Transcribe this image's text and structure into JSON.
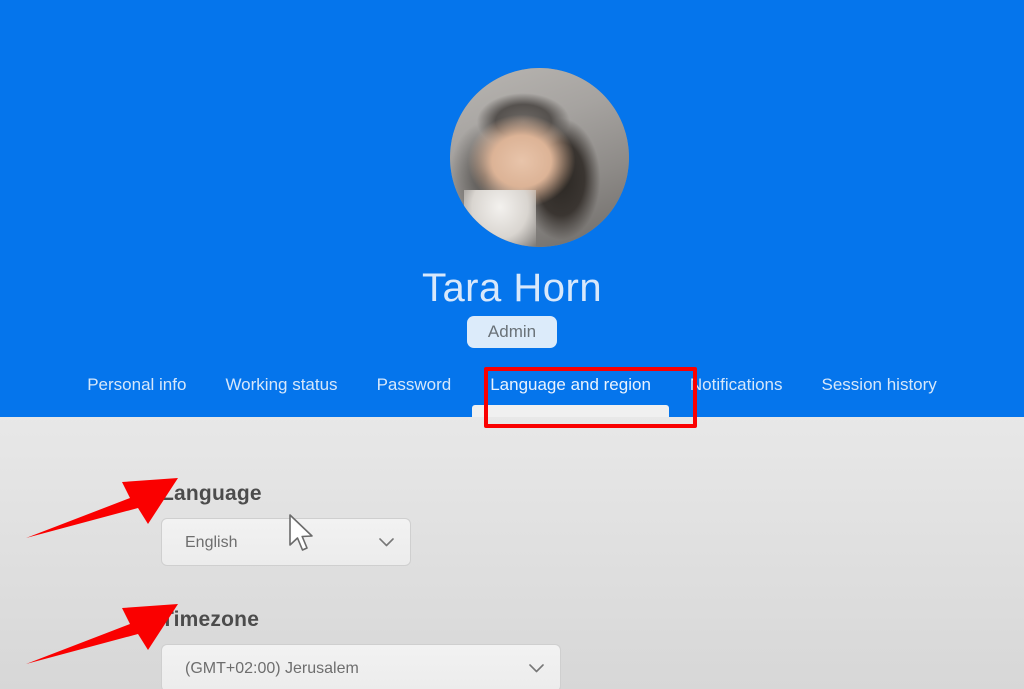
{
  "theme": {
    "header_blue": "#0575EC",
    "badge_bg": "#DCEBFA",
    "annotation_red": "#FA0000",
    "content_bg_top": "#FAFAFA",
    "content_bg_bottom": "#D7D7D7"
  },
  "profile": {
    "name": "Tara Horn",
    "role_badge": "Admin",
    "avatar_alt": "avatar-photo"
  },
  "tabs": [
    {
      "id": "personal-info",
      "label": "Personal info",
      "active": false
    },
    {
      "id": "working-status",
      "label": "Working status",
      "active": false
    },
    {
      "id": "password",
      "label": "Password",
      "active": false
    },
    {
      "id": "language-and-region",
      "label": "Language and region",
      "active": true
    },
    {
      "id": "notifications",
      "label": "Notifications",
      "active": false
    },
    {
      "id": "session-history",
      "label": "Session history",
      "active": false
    }
  ],
  "form": {
    "language": {
      "label": "Language",
      "value": "English",
      "chevron": "chevron-down-icon"
    },
    "timezone": {
      "label": "Timezone",
      "value": "(GMT+02:00) Jerusalem",
      "chevron": "chevron-down-icon"
    }
  },
  "annotations": {
    "highlight_box_target": "Language and region",
    "arrows": [
      {
        "id": "arrow-language",
        "points_to": "Language"
      },
      {
        "id": "arrow-timezone",
        "points_to": "Timezone"
      }
    ]
  }
}
